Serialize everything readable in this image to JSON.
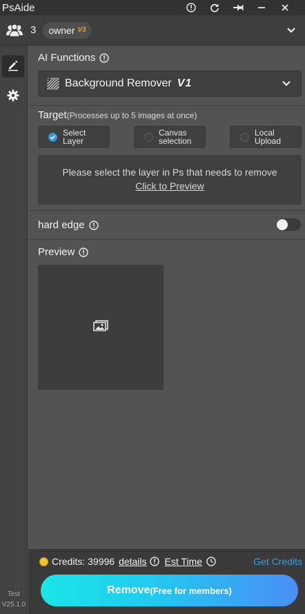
{
  "app": {
    "title": "PsAide"
  },
  "titlebar": {
    "icons": [
      "info-icon",
      "refresh-icon",
      "pin-icon",
      "minimize-icon",
      "close-icon"
    ]
  },
  "user": {
    "count": "3",
    "role": "owner",
    "role_version": "V3"
  },
  "sidebar": {
    "items": [
      {
        "name": "edit",
        "icon": "pencil-icon",
        "active": true
      },
      {
        "name": "settings",
        "icon": "gear-icon",
        "active": false
      }
    ],
    "version_label": "Test",
    "version": "V25.1.0"
  },
  "ai_functions": {
    "label": "AI Functions",
    "selected": "Background Remover",
    "selected_version": "V1"
  },
  "target": {
    "label": "Target",
    "hint": "(Processes up to 5 images at once)",
    "options": [
      {
        "line1": "Select",
        "line2": "Layer",
        "selected": true
      },
      {
        "line1": "Canvas",
        "line2": "selection",
        "selected": false
      },
      {
        "line1": "Local",
        "line2": "Upload",
        "selected": false
      }
    ],
    "notice": "Please select the layer in Ps that needs to remove",
    "preview_link": "Click to Preview"
  },
  "hard_edge": {
    "label": "hard edge",
    "enabled": false
  },
  "preview": {
    "label": "Preview",
    "placeholder_icon": "image-icon"
  },
  "footer": {
    "credits_label": "Credits: 39996",
    "details": "details",
    "est_time": "Est Time",
    "get_credits": "Get Credits",
    "remove_label": "Remove",
    "remove_sub": "(Free for members)"
  },
  "colors": {
    "accent": "#2d9cdb",
    "link": "#3a9bd9",
    "button_gradient_start": "#19e6e6",
    "button_gradient_end": "#4a8df5",
    "version_badge": "#e0a43a"
  }
}
